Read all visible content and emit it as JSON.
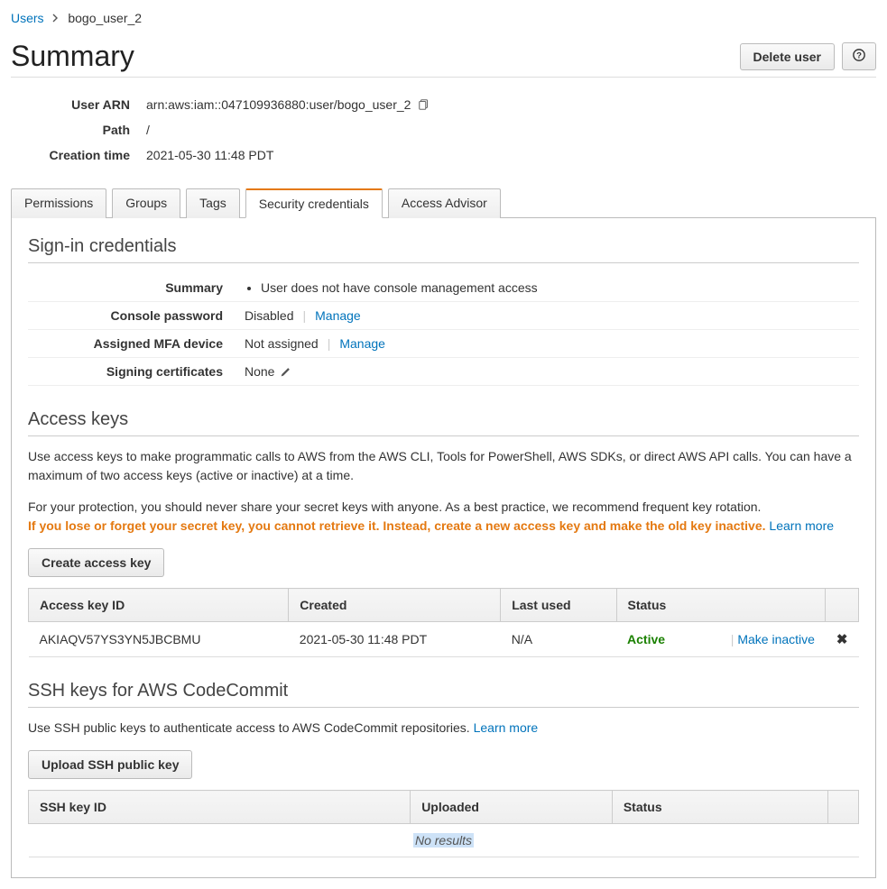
{
  "breadcrumb": {
    "root": "Users",
    "current": "bogo_user_2"
  },
  "header": {
    "title": "Summary",
    "delete_label": "Delete user"
  },
  "summary": {
    "arn_label": "User ARN",
    "arn_value": "arn:aws:iam::047109936880:user/bogo_user_2",
    "path_label": "Path",
    "path_value": "/",
    "creation_label": "Creation time",
    "creation_value": "2021-05-30 11:48 PDT"
  },
  "tabs": {
    "permissions": "Permissions",
    "groups": "Groups",
    "tags": "Tags",
    "security": "Security credentials",
    "advisor": "Access Advisor"
  },
  "signin": {
    "section_title": "Sign-in credentials",
    "summary_label": "Summary",
    "summary_bullet": "User does not have console management access",
    "console_pw_label": "Console password",
    "console_pw_value": "Disabled",
    "mfa_label": "Assigned MFA device",
    "mfa_value": "Not assigned",
    "cert_label": "Signing certificates",
    "cert_value": "None",
    "manage": "Manage"
  },
  "accesskeys": {
    "section_title": "Access keys",
    "desc1": "Use access keys to make programmatic calls to AWS from the AWS CLI, Tools for PowerShell, AWS SDKs, or direct AWS API calls. You can have a maximum of two access keys (active or inactive) at a time.",
    "desc2a": "For your protection, you should never share your secret keys with anyone. As a best practice, we recommend frequent key rotation.",
    "desc2b_warn": "If you lose or forget your secret key, you cannot retrieve it. Instead, create a new access key and make the old key inactive.",
    "learn_more": "Learn more",
    "create_btn": "Create access key",
    "cols": {
      "id": "Access key ID",
      "created": "Created",
      "lastused": "Last used",
      "status": "Status"
    },
    "rows": [
      {
        "id": "AKIAQV57YS3YN5JBCBMU",
        "created": "2021-05-30 11:48 PDT",
        "lastused": "N/A",
        "status": "Active",
        "action": "Make inactive"
      }
    ]
  },
  "ssh": {
    "section_title": "SSH keys for AWS CodeCommit",
    "desc": "Use SSH public keys to authenticate access to AWS CodeCommit repositories.",
    "learn_more": "Learn more",
    "upload_btn": "Upload SSH public key",
    "cols": {
      "id": "SSH key ID",
      "uploaded": "Uploaded",
      "status": "Status"
    },
    "no_results": "No results"
  }
}
